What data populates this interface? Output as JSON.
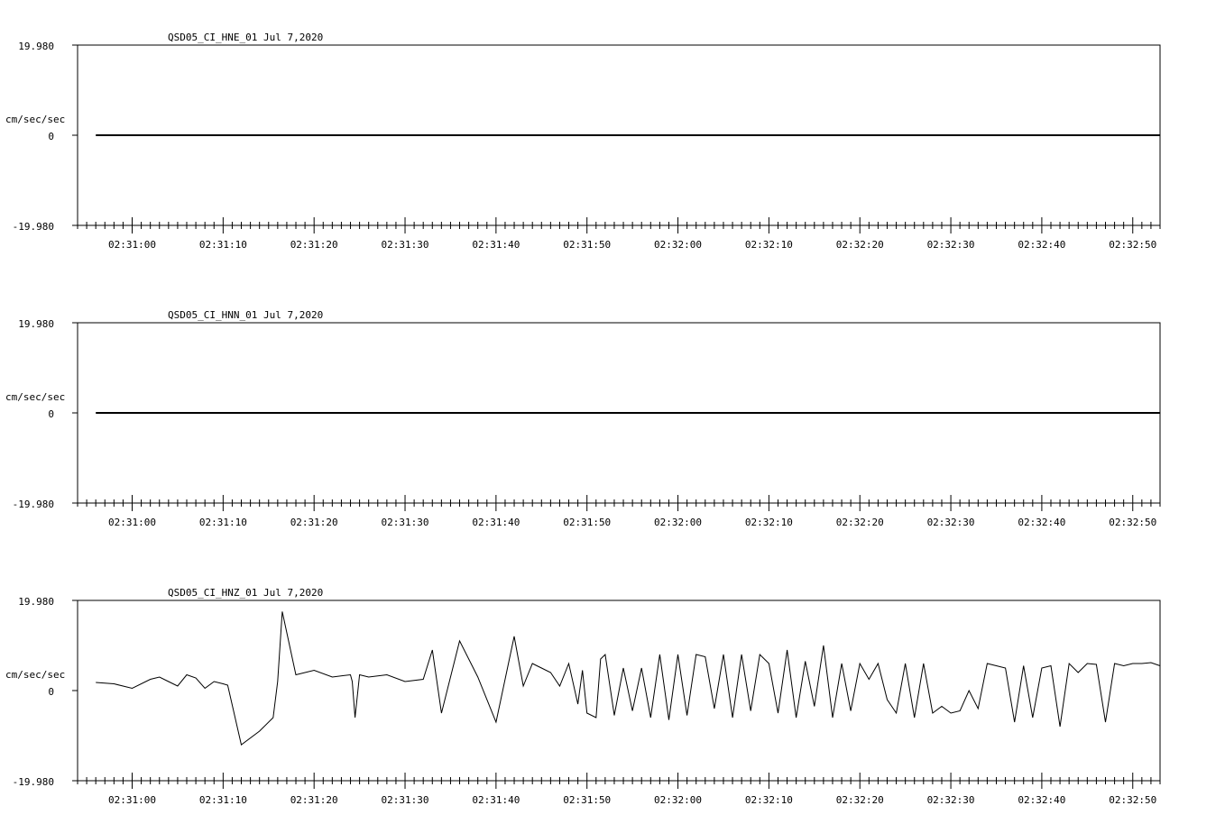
{
  "chart_data": [
    {
      "type": "line",
      "title": "QSD05_CI_HNE_01  Jul 7,2020",
      "ylabel": "cm/sec/sec",
      "ytick_labels": [
        "19.980",
        "0",
        "-19.980"
      ],
      "ylim": [
        -19.98,
        19.98
      ],
      "x_tick_labels": [
        "02:31:00",
        "02:31:10",
        "02:31:20",
        "02:31:30",
        "02:31:40",
        "02:31:50",
        "02:32:00",
        "02:32:10",
        "02:32:20",
        "02:32:30",
        "02:32:40",
        "02:32:50"
      ],
      "x_start_seconds": 54,
      "x_end_seconds": 173,
      "signal_start_seconds": 56,
      "series": [
        {
          "x": [
            56,
            173
          ],
          "y": [
            0,
            0
          ]
        }
      ]
    },
    {
      "type": "line",
      "title": "QSD05_CI_HNN_01  Jul 7,2020",
      "ylabel": "cm/sec/sec",
      "ytick_labels": [
        "19.980",
        "0",
        "-19.980"
      ],
      "ylim": [
        -19.98,
        19.98
      ],
      "x_tick_labels": [
        "02:31:00",
        "02:31:10",
        "02:31:20",
        "02:31:30",
        "02:31:40",
        "02:31:50",
        "02:32:00",
        "02:32:10",
        "02:32:20",
        "02:32:30",
        "02:32:40",
        "02:32:50"
      ],
      "x_start_seconds": 54,
      "x_end_seconds": 173,
      "signal_start_seconds": 56,
      "series": [
        {
          "x": [
            56,
            173
          ],
          "y": [
            0,
            0
          ]
        }
      ]
    },
    {
      "type": "line",
      "title": "QSD05_CI_HNZ_01  Jul 7,2020",
      "ylabel": "cm/sec/sec",
      "ytick_labels": [
        "19.980",
        "0",
        "-19.980"
      ],
      "ylim": [
        -19.98,
        19.98
      ],
      "x_tick_labels": [
        "02:31:00",
        "02:31:10",
        "02:31:20",
        "02:31:30",
        "02:31:40",
        "02:31:50",
        "02:32:00",
        "02:32:10",
        "02:32:20",
        "02:32:30",
        "02:32:40",
        "02:32:50"
      ],
      "x_start_seconds": 54,
      "x_end_seconds": 173,
      "signal_start_seconds": 56,
      "series": [
        {
          "x": [
            56,
            58,
            60,
            62,
            63,
            64,
            65,
            66,
            67,
            68,
            69,
            70,
            70.5,
            72,
            74,
            75.5,
            76,
            76.5,
            78,
            80,
            82,
            84,
            84.2,
            84.5,
            85,
            86,
            88,
            90,
            92,
            93,
            94,
            96,
            98,
            100,
            102,
            103,
            104,
            104.5,
            105,
            106,
            107,
            108,
            109,
            109.5,
            110,
            111,
            111.5,
            112,
            113,
            114,
            115,
            116,
            117,
            118,
            119,
            120,
            121,
            122,
            123,
            124,
            125,
            126,
            127,
            128,
            129,
            130,
            131,
            132,
            133,
            134,
            135,
            136,
            137,
            138,
            139,
            140,
            141,
            142,
            143,
            144,
            145,
            146,
            147,
            148,
            149,
            150,
            151,
            152,
            153,
            154,
            155,
            156,
            157,
            158,
            159,
            160,
            161,
            162,
            163,
            164,
            165,
            166,
            167,
            168,
            169,
            170,
            171,
            172,
            173
          ],
          "y": [
            1.8,
            1.5,
            0.5,
            2.5,
            3.0,
            2.0,
            1.0,
            3.5,
            2.8,
            0.5,
            2.0,
            1.5,
            1.2,
            -12.0,
            -9.0,
            -6.0,
            2.0,
            17.5,
            3.5,
            4.5,
            3.0,
            3.5,
            2.0,
            -6.0,
            3.5,
            3.0,
            3.5,
            2.0,
            2.5,
            9.0,
            -5.0,
            11.0,
            3.0,
            -7.0,
            12.0,
            1.0,
            6.0,
            5.5,
            5.0,
            4.0,
            1.0,
            6.0,
            -3.0,
            4.5,
            -5.0,
            -6.0,
            7.0,
            8.0,
            -5.5,
            5.0,
            -4.5,
            5.0,
            -6.0,
            8.0,
            -6.5,
            8.0,
            -5.5,
            8.0,
            7.5,
            -4.0,
            8.0,
            -6.0,
            8.0,
            -4.5,
            8.0,
            6.0,
            -5.0,
            9.0,
            -6.0,
            6.5,
            -3.5,
            10.0,
            -6.0,
            6.0,
            -4.5,
            6.0,
            2.5,
            6.0,
            -2.0,
            -5.0,
            6.0,
            -6.0,
            6.0,
            -5.0,
            -3.5,
            -5.0,
            -4.5,
            0.0,
            -4.0,
            6.0,
            5.5,
            5.0,
            -7.0,
            5.5,
            -6.0,
            5.0,
            5.5,
            -8.0,
            6.0,
            4.0,
            6.0,
            5.8,
            -7.0,
            6.0,
            5.5,
            6.0,
            6.0,
            6.2,
            5.5
          ]
        }
      ]
    }
  ]
}
